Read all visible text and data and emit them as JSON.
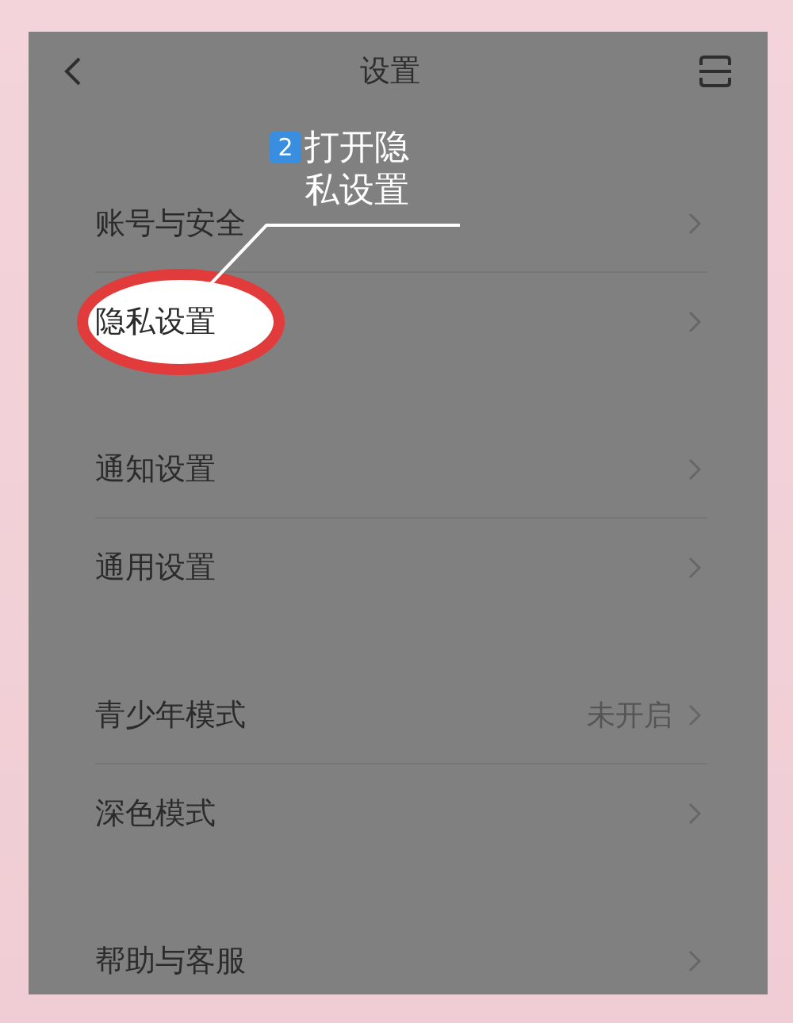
{
  "header": {
    "title": "设置"
  },
  "annotation": {
    "step": "2",
    "text": "打开隐私设置"
  },
  "groups": [
    {
      "rows": [
        {
          "label": "账号与安全",
          "circled": false
        },
        {
          "label": "隐私设置",
          "circled": true
        }
      ]
    },
    {
      "rows": [
        {
          "label": "通知设置",
          "circled": false
        },
        {
          "label": "通用设置",
          "circled": false
        }
      ]
    },
    {
      "rows": [
        {
          "label": "青少年模式",
          "value": "未开启",
          "circled": false
        },
        {
          "label": "深色模式",
          "circled": false
        }
      ]
    },
    {
      "rows": [
        {
          "label": "帮助与客服",
          "circled": false
        }
      ]
    }
  ]
}
